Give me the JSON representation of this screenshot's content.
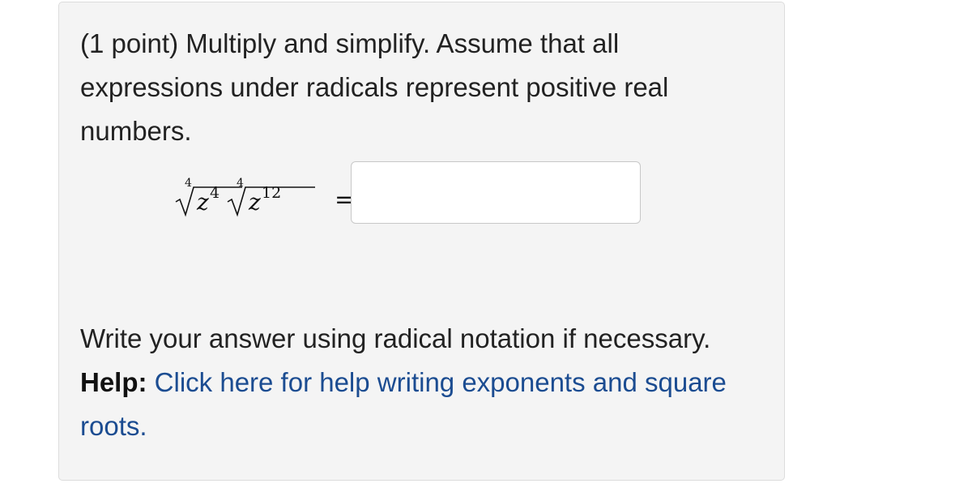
{
  "problem": {
    "prompt": "(1 point) Multiply and simplify. Assume that all expressions under radicals represent positive real numbers.",
    "equation": {
      "radicals": [
        {
          "index": "4",
          "base": "z",
          "exponent": "4"
        },
        {
          "index": "4",
          "base": "z",
          "exponent": "12"
        }
      ],
      "equals": "="
    },
    "answer": {
      "value": "",
      "placeholder": ""
    },
    "note": "Write your answer using radical notation if necessary.",
    "help": {
      "label": "Help:",
      "link_text": "Click here for help writing exponents and square roots."
    }
  }
}
